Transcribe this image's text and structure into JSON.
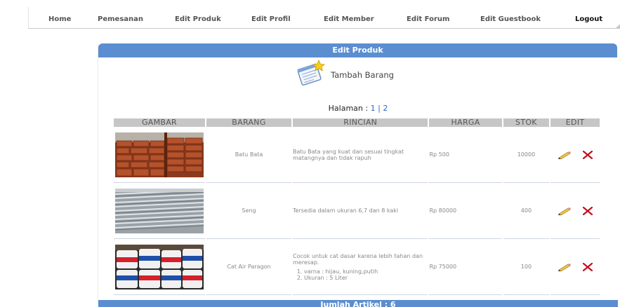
{
  "nav": {
    "items": [
      "Home",
      "Pemesanan",
      "Edit Produk",
      "Edit Profil",
      "Edit Member",
      "Edit Forum",
      "Edit Guestbook",
      "Logout"
    ]
  },
  "panel": {
    "title": "Edit Produk",
    "add_label": "Tambah Barang",
    "pagination": {
      "prefix": "Halaman :",
      "page1": "1",
      "sep": "|",
      "page2": "2"
    },
    "columns": [
      "GAMBAR",
      "BARANG",
      "RINCIAN",
      "HARGA",
      "STOK",
      "EDIT"
    ],
    "rows": [
      {
        "image_icon": "bricks-photo",
        "name": "Batu Bata",
        "desc": "Batu Bata yang kuat dan sesuai tingkat matangnya dan tidak rapuh",
        "price": "Rp 500",
        "stock": "10000"
      },
      {
        "image_icon": "zinc-roof-photo",
        "name": "Seng",
        "desc": "Tersedia dalam ukuran 6,7 dan 8 kaki",
        "price": "Rp 80000",
        "stock": "400"
      },
      {
        "image_icon": "paint-cans-photo",
        "name": "Cat Air Paragon",
        "desc": "Cocok untuk cat dasar karena lebih tahan dan meresap.",
        "desc_list": [
          "varna : hijau, kuning,putih",
          "Ukuran : 5 Liter"
        ],
        "price": "Rp 75000",
        "stock": "100"
      }
    ],
    "footer": "Jumlah Artikel : 6"
  },
  "colors": {
    "header_blue": "#5b8ed0",
    "column_gray": "#c6c6c6",
    "link_blue": "#2a68c8",
    "delete_red": "#c0121b"
  }
}
